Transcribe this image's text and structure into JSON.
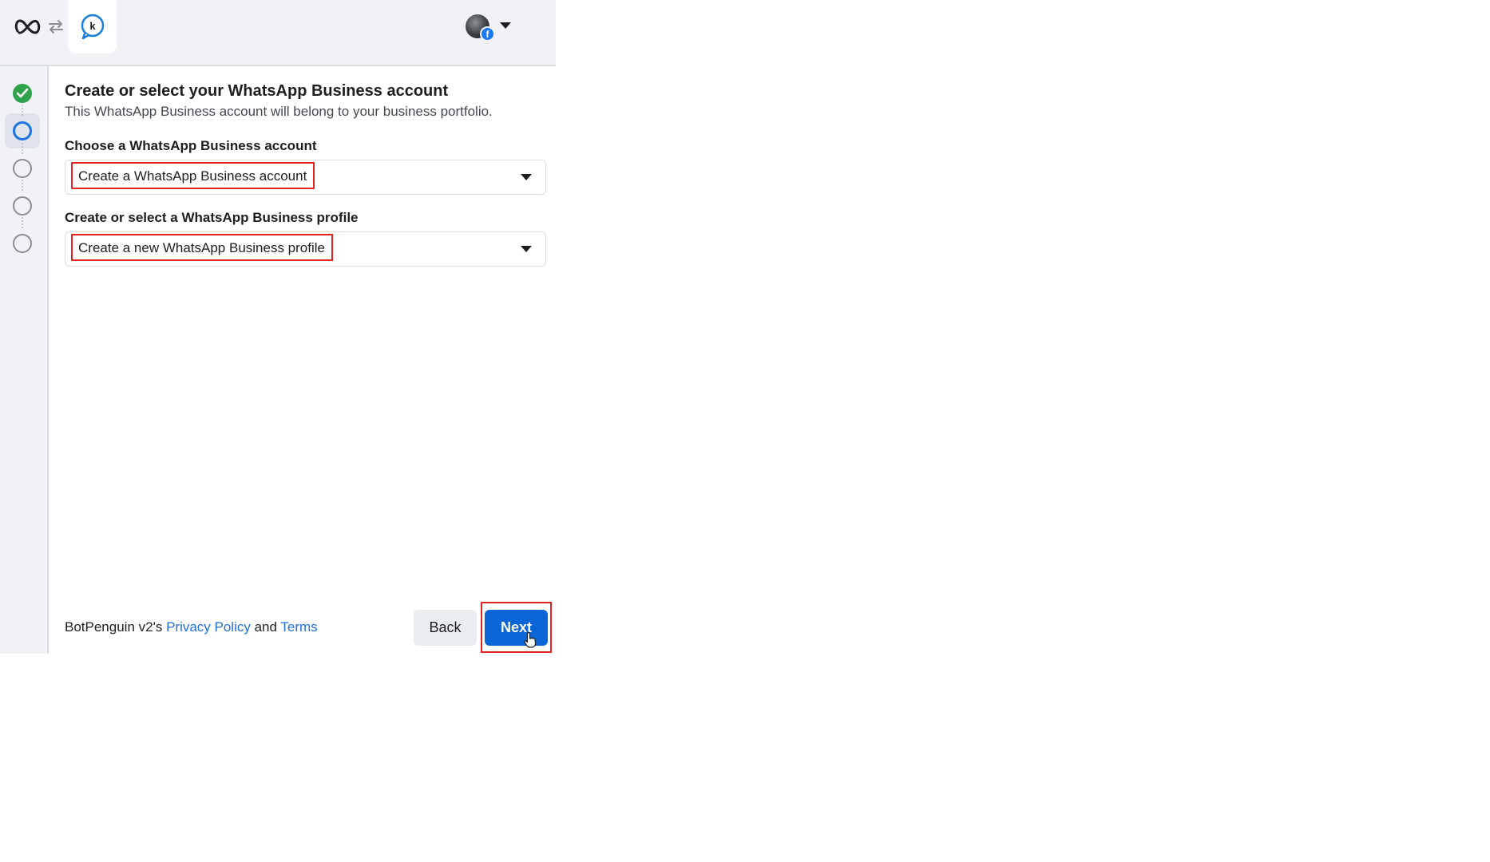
{
  "header": {
    "logo_icon": "meta-logo-icon",
    "swap_icon": "swap-arrows-icon",
    "app_icon": "botpenguin-chat-icon",
    "account_icon": "profile-avatar",
    "account_badge": "f"
  },
  "stepper": {
    "steps": [
      {
        "state": "done"
      },
      {
        "state": "current"
      },
      {
        "state": "todo"
      },
      {
        "state": "todo"
      },
      {
        "state": "todo"
      }
    ],
    "colors": {
      "done": "#31a24c",
      "current": "#1b74e4",
      "todo": "#8a8d91"
    }
  },
  "main": {
    "title": "Create or select your WhatsApp Business account",
    "subtitle": "This WhatsApp Business account will belong to your business portfolio.",
    "account_field": {
      "label": "Choose a WhatsApp Business account",
      "value": "Create a WhatsApp Business account"
    },
    "profile_field": {
      "label": "Create or select a WhatsApp Business profile",
      "value": "Create a new WhatsApp Business profile"
    }
  },
  "footer": {
    "prefix": "BotPenguin v2's ",
    "privacy_link": "Privacy Policy",
    "and": " and ",
    "terms_link": "Terms",
    "back_label": "Back",
    "next_label": "Next"
  },
  "colors": {
    "accent": "#0a66d6",
    "link": "#216fdb",
    "highlight": "#e02424"
  }
}
